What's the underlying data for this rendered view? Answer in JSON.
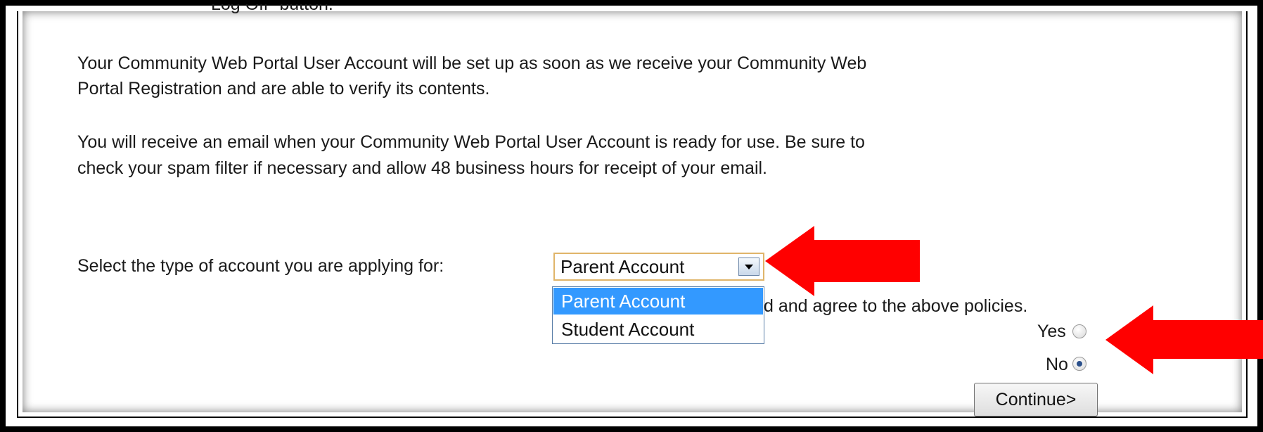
{
  "content": {
    "cut_line": "Log Off\" button.",
    "para1_line1": "Your Community Web Portal User Account will be set up as soon as we receive your Community Web",
    "para1_line2": "Portal Registration and are able to verify its contents.",
    "para2_line1": "You will receive an email when your Community Web Portal User Account is ready for use. Be sure to",
    "para2_line2": "check your spam filter if necessary and allow 48 business hours for receipt of your email."
  },
  "account_type": {
    "label": "Select the type of account you are applying for:",
    "selected": "Parent Account",
    "options": [
      "Parent Account",
      "Student Account"
    ],
    "highlighted_index": 0
  },
  "policy": {
    "partial_text": "d and agree to the above policies.",
    "yes_label": "Yes",
    "no_label": "No",
    "selected": "No"
  },
  "buttons": {
    "continue_label": "Continue>"
  },
  "colors": {
    "annotation_arrow": "#ff0000",
    "highlight": "#3399ff"
  },
  "icons": {
    "arrow_1": "red-arrow-left-icon",
    "arrow_2": "red-arrow-left-icon",
    "dropdown": "chevron-down-icon"
  }
}
